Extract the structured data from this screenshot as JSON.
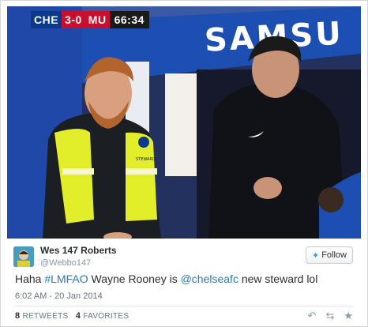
{
  "scoreboard": {
    "home": "CHE",
    "score": "3-0",
    "away": "MU",
    "clock": "66:34"
  },
  "banner_text": "SAMSU",
  "badge_text": "STEWARD",
  "tweet": {
    "display_name": "Wes 147 Roberts",
    "handle": "@Webbo147",
    "follow_label": "Follow",
    "text_parts": {
      "p1": "Haha ",
      "hashtag": "#LMFAO",
      "p2": " Wayne Rooney is ",
      "mention": "@chelseafc",
      "p3": " new steward lol"
    },
    "timestamp": "6:02 AM - 20 Jan 2014",
    "retweets_count": "8",
    "retweets_label": "RETWEETS",
    "favorites_count": "4",
    "favorites_label": "FAVORITES"
  },
  "icons": {
    "follow": "twitter-bird-icon",
    "reply": "reply-icon",
    "retweet": "retweet-icon",
    "favorite": "star-icon"
  },
  "colors": {
    "chelsea_blue": "#0b3a8a",
    "hivis_yellow": "#e3ee2a",
    "link_blue": "#2b7bb9",
    "scoreboard_red": "#c8102e"
  }
}
